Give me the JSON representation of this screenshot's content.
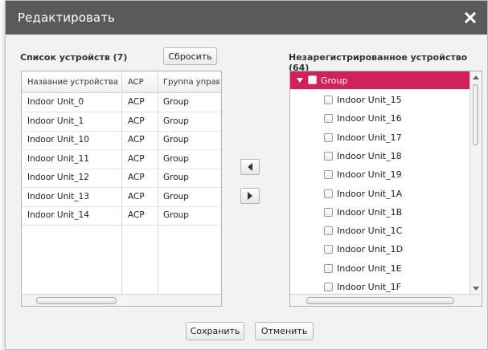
{
  "dialog": {
    "title": "Редактировать",
    "close_icon": "close-icon"
  },
  "left": {
    "title": "Список устройств (7)",
    "reset_label": "Сбросить",
    "columns": [
      "Название устройства",
      "ACP",
      "Группа управ."
    ],
    "rows": [
      [
        "Indoor Unit_0",
        "ACP",
        "Group"
      ],
      [
        "Indoor Unit_1",
        "ACP",
        "Group"
      ],
      [
        "Indoor Unit_10",
        "ACP",
        "Group"
      ],
      [
        "Indoor Unit_11",
        "ACP",
        "Group"
      ],
      [
        "Indoor Unit_12",
        "ACP",
        "Group"
      ],
      [
        "Indoor Unit_13",
        "ACP",
        "Group"
      ],
      [
        "Indoor Unit_14",
        "ACP",
        "Group"
      ]
    ]
  },
  "move": {
    "left_icon": "arrow-left-icon",
    "right_icon": "arrow-right-icon"
  },
  "right": {
    "title": "Незарегистрированное устройство (64)",
    "group_label": "Group",
    "items": [
      "Indoor Unit_15",
      "Indoor Unit_16",
      "Indoor Unit_17",
      "Indoor Unit_18",
      "Indoor Unit_19",
      "Indoor Unit_1A",
      "Indoor Unit_1B",
      "Indoor Unit_1C",
      "Indoor Unit_1D",
      "Indoor Unit_1E",
      "Indoor Unit_1F"
    ]
  },
  "footer": {
    "save_label": "Сохранить",
    "cancel_label": "Отменить"
  },
  "colors": {
    "titlebar": "#5a5a5a",
    "group_highlight": "#d1205a"
  }
}
